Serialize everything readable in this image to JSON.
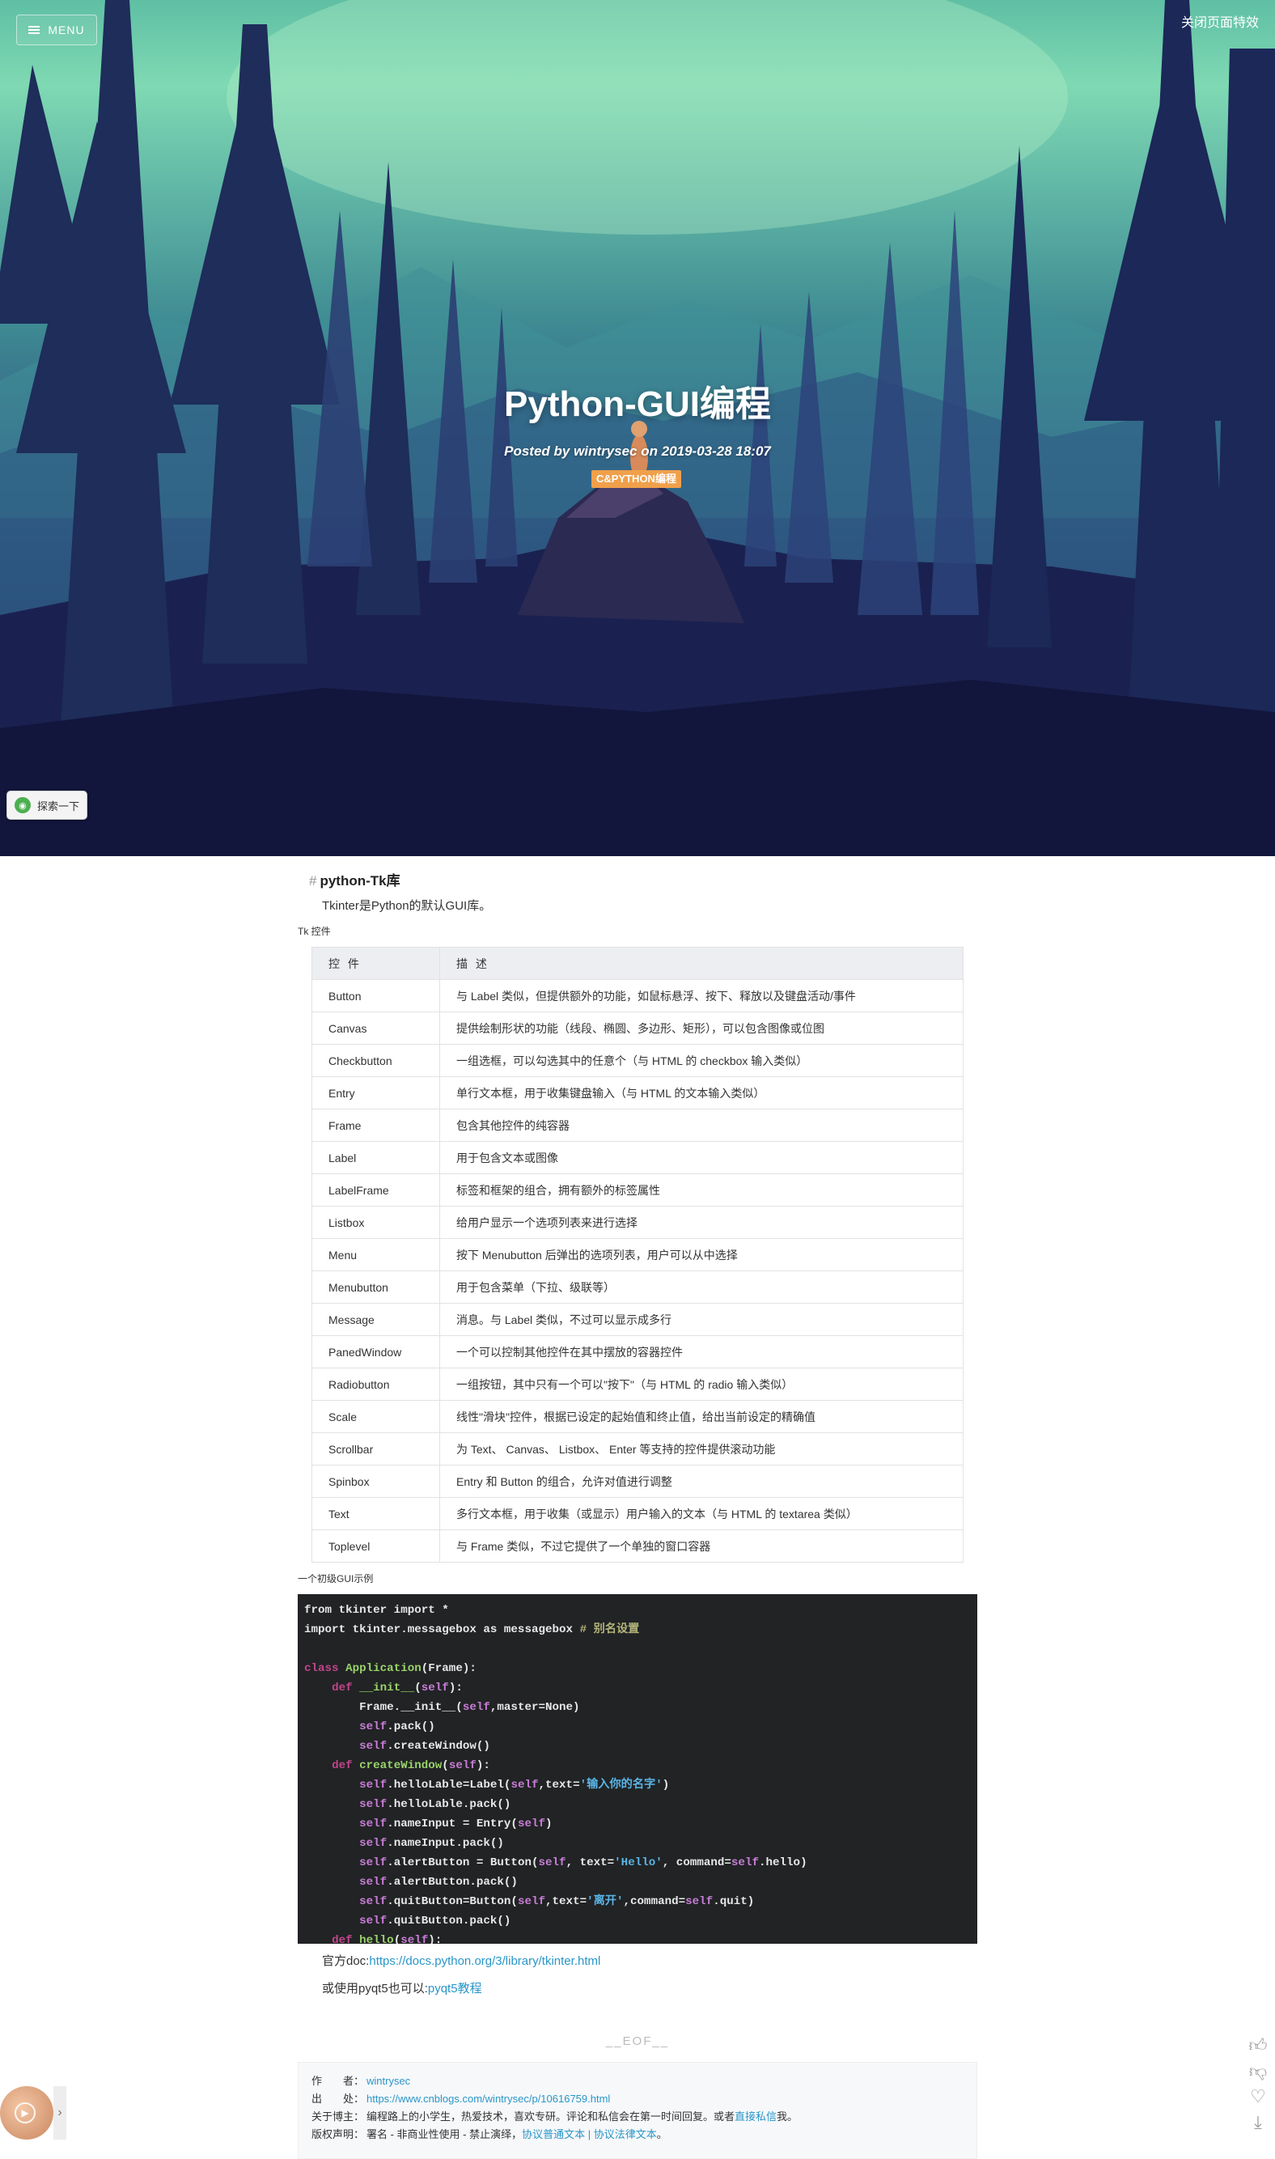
{
  "header": {
    "menu_label": "MENU",
    "effects_toggle": "关闭页面特效"
  },
  "hero": {
    "title": "Python-GUI编程",
    "meta": "Posted by wintrysec on 2019-03-28 18:07",
    "tag": "C&PYTHON编程",
    "explore_label": "探索一下",
    "explore_icon": "compass-icon"
  },
  "article": {
    "heading": "python-Tk库",
    "intro": "Tkinter是Python的默认GUI库。",
    "table_caption": "Tk 控件",
    "table_headers": [
      "控 件",
      "描 述"
    ],
    "widgets": [
      [
        "Button",
        "与 Label 类似，但提供额外的功能，如鼠标悬浮、按下、释放以及键盘活动/事件"
      ],
      [
        "Canvas",
        "提供绘制形状的功能（线段、椭圆、多边形、矩形），可以包含图像或位图"
      ],
      [
        "Checkbutton",
        "一组选框，可以勾选其中的任意个（与 HTML 的 checkbox 输入类似）"
      ],
      [
        "Entry",
        "单行文本框，用于收集键盘输入（与 HTML 的文本输入类似）"
      ],
      [
        "Frame",
        "包含其他控件的纯容器"
      ],
      [
        "Label",
        "用于包含文本或图像"
      ],
      [
        "LabelFrame",
        "标签和框架的组合，拥有额外的标签属性"
      ],
      [
        "Listbox",
        "给用户显示一个选项列表来进行选择"
      ],
      [
        "Menu",
        "按下 Menubutton 后弹出的选项列表，用户可以从中选择"
      ],
      [
        "Menubutton",
        "用于包含菜单（下拉、级联等）"
      ],
      [
        "Message",
        "消息。与 Label 类似，不过可以显示成多行"
      ],
      [
        "PanedWindow",
        "一个可以控制其他控件在其中摆放的容器控件"
      ],
      [
        "Radiobutton",
        "一组按钮，其中只有一个可以\"按下\"（与 HTML 的 radio 输入类似）"
      ],
      [
        "Scale",
        "线性\"滑块\"控件，根据已设定的起始值和终止值，给出当前设定的精确值"
      ],
      [
        "Scrollbar",
        "为 Text、 Canvas、 Listbox、 Enter 等支持的控件提供滚动功能"
      ],
      [
        "Spinbox",
        "Entry 和 Button 的组合，允许对值进行调整"
      ],
      [
        "Text",
        "多行文本框，用于收集（或显示）用户输入的文本（与 HTML 的 textarea 类似）"
      ],
      [
        "Toplevel",
        "与 Frame 类似，不过它提供了一个单独的窗口容器"
      ]
    ],
    "example_caption": "一个初级GUI示例",
    "code_lines": [
      "from tkinter import *",
      "import tkinter.messagebox as messagebox # 别名设置",
      "",
      "class Application(Frame):",
      "    def __init__(self):",
      "        Frame.__init__(self,master=None)",
      "        self.pack()",
      "        self.createWindow()",
      "    def createWindow(self):",
      "        self.helloLable=Label(self,text='输入你的名字')",
      "        self.helloLable.pack()",
      "        self.nameInput = Entry(self)",
      "        self.nameInput.pack()",
      "        self.alertButton = Button(self, text='Hello', command=self.hello)",
      "        self.alertButton.pack()",
      "        self.quitButton=Button(self,text='离开',command=self.quit)",
      "        self.quitButton.pack()",
      "    def hello(self):"
    ],
    "doc_prefix": "官方doc:",
    "doc_link": "https://docs.python.org/3/library/tkinter.html",
    "pyqt_prefix": "或使用pyqt5也可以:",
    "pyqt_link": "pyqt5教程",
    "eof": "__EOF__"
  },
  "info": {
    "author_label": "作　　者：",
    "author": "wintrysec",
    "source_label": "出　　处：",
    "source": "https://www.cnblogs.com/wintrysec/p/10616759.html",
    "about_label": "关于博主：",
    "about": "编程路上的小学生，热爱技术，喜欢专研。评论和私信会在第一时间回复。或者",
    "about_link": "直接私信",
    "about_tail": "我。",
    "copyright_label": "版权声明：",
    "copyright": "署名 - 非商业性使用 - 禁止演绎，",
    "copyright_link": "协议普通文本 | 协议法律文本",
    "copyright_tail": "。"
  },
  "side_tools": [
    "thumbs-up-icon",
    "thumbs-down-icon",
    "heart-icon",
    "download-icon"
  ],
  "colors": {
    "tag_bg": "#f0a04b",
    "link": "#2a96c8",
    "code_bg": "#212325"
  }
}
